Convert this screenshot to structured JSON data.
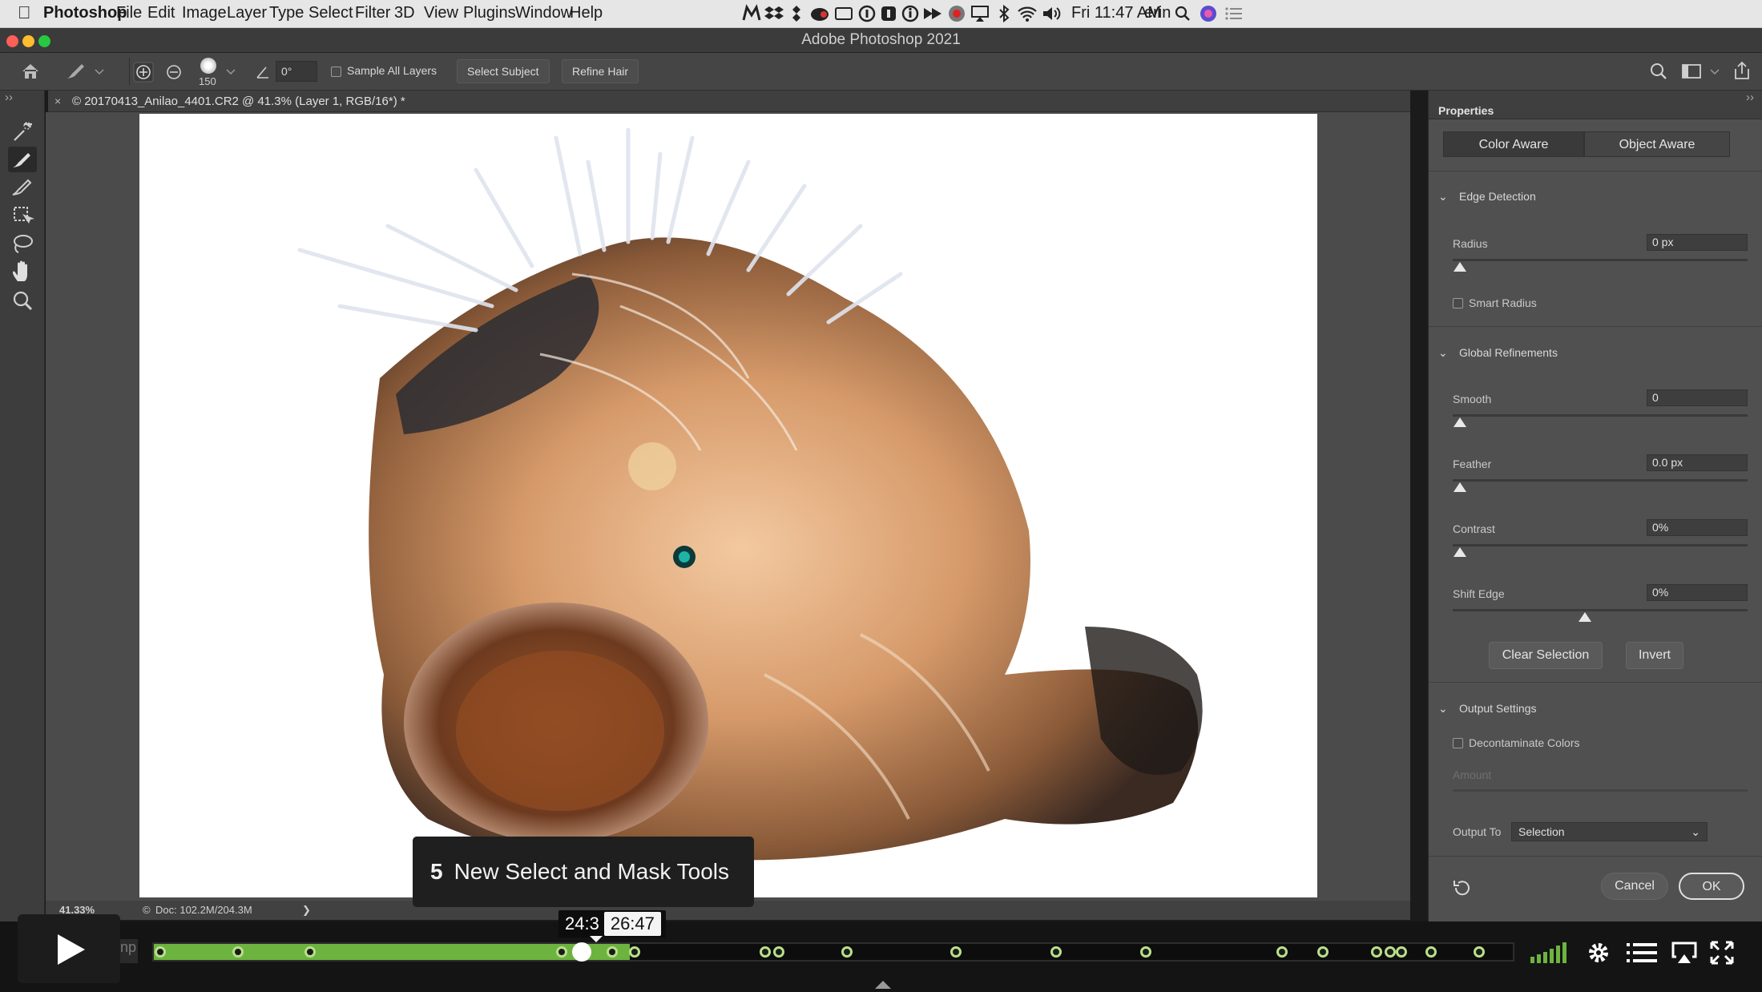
{
  "menubar": {
    "app_name": "Photoshop",
    "items": [
      "File",
      "Edit",
      "Image",
      "Layer",
      "Type",
      "Select",
      "Filter",
      "3D",
      "View",
      "Plugins",
      "Window",
      "Help"
    ],
    "clock": "Fri 11:47 AM",
    "user": "erin",
    "status_icons": [
      "malwarebytes-icon",
      "dropbox-icon",
      "dropbox-alt-icon",
      "creative-cloud-icon",
      "display-icon",
      "1password-icon",
      "one-icon",
      "info-icon",
      "fast-forward-icon",
      "record-icon",
      "airplay-icon",
      "bluetooth-icon",
      "wifi-icon",
      "volume-icon",
      "spotlight-search-icon",
      "siri-icon",
      "notification-center-icon"
    ]
  },
  "window": {
    "title": "Adobe Photoshop 2021"
  },
  "options_bar": {
    "brush_size": "150",
    "angle": "0°",
    "sample_all_layers": "Sample All Layers",
    "select_subject": "Select Subject",
    "refine_hair": "Refine Hair"
  },
  "document_tab": {
    "title": "© 20170413_Anilao_4401.CR2 @ 41.3% (Layer 1, RGB/16*) *"
  },
  "status_bar": {
    "zoom": "41.33%",
    "doc_size": "Doc: 102.2M/204.3M",
    "arrow": "❯"
  },
  "panel": {
    "title": "Properties",
    "segments": [
      "Color Aware",
      "Object Aware"
    ],
    "edge_detection": {
      "heading": "Edge Detection",
      "radius_label": "Radius",
      "radius_value": "0 px",
      "smart_radius": "Smart Radius"
    },
    "global_refinements": {
      "heading": "Global Refinements",
      "smooth_label": "Smooth",
      "smooth_value": "0",
      "feather_label": "Feather",
      "feather_value": "0.0 px",
      "contrast_label": "Contrast",
      "contrast_value": "0%",
      "shift_edge_label": "Shift Edge",
      "shift_edge_value": "0%",
      "clear_selection": "Clear Selection",
      "invert": "Invert"
    },
    "output_settings": {
      "heading": "Output Settings",
      "decontaminate": "Decontaminate Colors",
      "amount_label": "Amount",
      "output_to_label": "Output To",
      "output_to_value": "Selection"
    },
    "cancel": "Cancel",
    "ok": "OK"
  },
  "video": {
    "chapter_number": "5",
    "chapter_title": "New Select and Mask Tools",
    "hover_time_partial": "24:3",
    "hover_time": "26:47",
    "progress_fraction": 0.35,
    "chapter_marker_positions": [
      0.005,
      0.062,
      0.115,
      0.3,
      0.337,
      0.354,
      0.45,
      0.46,
      0.51,
      0.59,
      0.664,
      0.73,
      0.83,
      0.86,
      0.9,
      0.91,
      0.918,
      0.94,
      0.975
    ],
    "accent_color": "#6db33f"
  }
}
